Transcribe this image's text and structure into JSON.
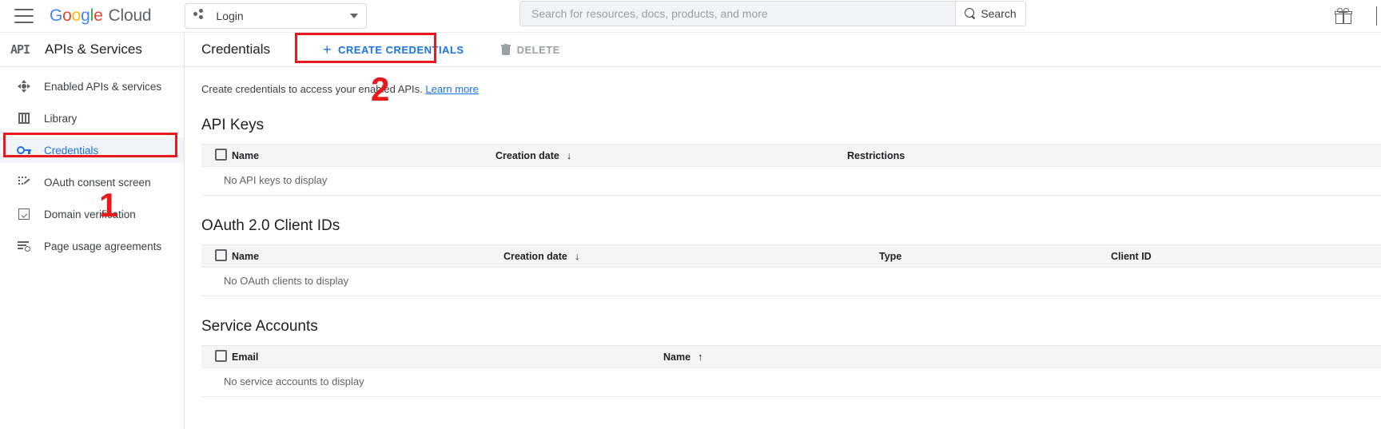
{
  "topbar": {
    "menu_icon": "hamburger-menu-icon",
    "brand": {
      "g": "G",
      "o1": "o",
      "o2": "o",
      "g2": "g",
      "l": "l",
      "e": "e",
      "cloud": "Cloud"
    },
    "project_picker": {
      "label": "Login",
      "icon": "project-dots-icon",
      "caret": "chevron-down-icon"
    },
    "search": {
      "placeholder": "Search for resources, docs, products, and more",
      "value": "",
      "button_label": "Search",
      "button_icon": "search-icon"
    },
    "gift_icon": "gift-icon"
  },
  "sidebar": {
    "logo_text": "API",
    "title": "APIs & Services",
    "items": [
      {
        "label": "Enabled APIs & services",
        "icon": "apis-compass-icon",
        "active": false
      },
      {
        "label": "Library",
        "icon": "library-icon",
        "active": false
      },
      {
        "label": "Credentials",
        "icon": "key-icon",
        "active": true
      },
      {
        "label": "OAuth consent screen",
        "icon": "oauth-consent-icon",
        "active": false
      },
      {
        "label": "Domain verification",
        "icon": "checkbox-verified-icon",
        "active": false
      },
      {
        "label": "Page usage agreements",
        "icon": "page-agreements-icon",
        "active": false
      }
    ]
  },
  "content": {
    "page_title": "Credentials",
    "create_button": {
      "label": "CREATE CREDENTIALS",
      "icon": "plus-icon"
    },
    "delete_button": {
      "label": "DELETE",
      "icon": "trash-icon"
    },
    "description": "Create credentials to access your enabled APIs.",
    "description_link": "Learn more",
    "sections": [
      {
        "title": "API Keys",
        "columns": [
          {
            "label": "Name",
            "sort": ""
          },
          {
            "label": "Creation date",
            "sort": "↓"
          },
          {
            "label": "Restrictions",
            "sort": ""
          }
        ],
        "empty_message": "No API keys to display"
      },
      {
        "title": "OAuth 2.0 Client IDs",
        "columns": [
          {
            "label": "Name",
            "sort": ""
          },
          {
            "label": "Creation date",
            "sort": "↓"
          },
          {
            "label": "Type",
            "sort": ""
          },
          {
            "label": "Client ID",
            "sort": ""
          }
        ],
        "empty_message": "No OAuth clients to display"
      },
      {
        "title": "Service Accounts",
        "columns": [
          {
            "label": "Email",
            "sort": ""
          },
          {
            "label": "Name",
            "sort": "↑"
          }
        ],
        "empty_message": "No service accounts to display"
      }
    ]
  },
  "annotations": {
    "color": "#e8191b",
    "marks": [
      {
        "number": "1",
        "target": "sidebar-credentials"
      },
      {
        "number": "2",
        "target": "create-credentials-button"
      }
    ]
  }
}
